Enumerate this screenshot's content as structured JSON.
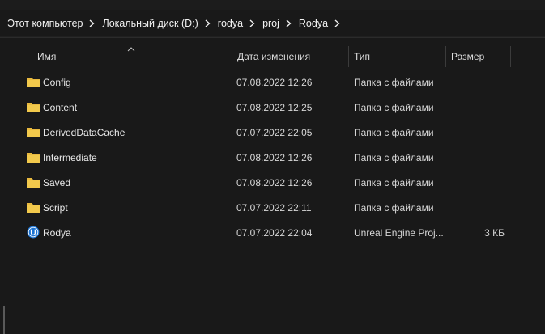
{
  "breadcrumb": [
    "Этот компьютер",
    "Локальный диск (D:)",
    "rodya",
    "proj",
    "Rodya"
  ],
  "columns": {
    "name": "Имя",
    "date": "Дата изменения",
    "type": "Тип",
    "size": "Размер"
  },
  "files": [
    {
      "name": "Config",
      "date": "07.08.2022 12:26",
      "type": "Папка с файлами",
      "size": "",
      "icon": "folder-icon"
    },
    {
      "name": "Content",
      "date": "07.08.2022 12:25",
      "type": "Папка с файлами",
      "size": "",
      "icon": "folder-icon"
    },
    {
      "name": "DerivedDataCache",
      "date": "07.07.2022 22:05",
      "type": "Папка с файлами",
      "size": "",
      "icon": "folder-icon"
    },
    {
      "name": "Intermediate",
      "date": "07.08.2022 12:26",
      "type": "Папка с файлами",
      "size": "",
      "icon": "folder-icon"
    },
    {
      "name": "Saved",
      "date": "07.08.2022 12:26",
      "type": "Папка с файлами",
      "size": "",
      "icon": "folder-icon"
    },
    {
      "name": "Script",
      "date": "07.07.2022 22:11",
      "type": "Папка с файлами",
      "size": "",
      "icon": "folder-icon"
    },
    {
      "name": "Rodya",
      "date": "07.07.2022 22:04",
      "type": "Unreal Engine Proj...",
      "size": "3 КБ",
      "icon": "unreal-engine-icon"
    }
  ],
  "colors": {
    "background": "#191919",
    "folder": "#e8b93f",
    "unreal": "#1a73d4"
  }
}
